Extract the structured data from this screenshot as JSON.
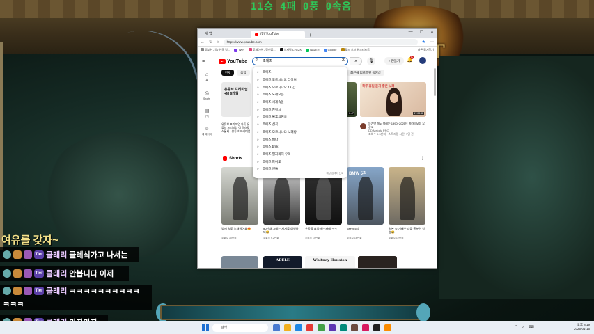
{
  "overlay": {
    "counter": "11승 4패 0풍 0속음",
    "chat_title": "여유를 갖자~",
    "messages": [
      {
        "user": "클래리",
        "text": "클레식가고 나서는"
      },
      {
        "user": "클래리",
        "text": "안봅니다 이제"
      },
      {
        "user": "클래리",
        "text": "ㅋㅋㅋㅋㅋㅋㅋㅋㅋㅋ"
      },
      {
        "user": "",
        "text": "ㅋㅋㅋ"
      },
      {
        "user": "클래리",
        "text": "마자마자"
      }
    ],
    "badge_label": "Tier",
    "game_logo": "FT"
  },
  "browser": {
    "tabs": [
      {
        "label": "새 탭"
      },
      {
        "label": "(8) YouTube"
      }
    ],
    "new_tab": "+",
    "window_controls": [
      "—",
      "☐",
      "✕"
    ],
    "url": "https://www.youtube.com",
    "bookmarks": [
      "맵부한 기능 연국 링...",
      "TWP",
      "투네이션 - 당신를...",
      "치지직 CHZZK",
      "NAVER",
      "Google",
      "월드 오브 워크래프트"
    ],
    "bookmarks_right": "다른 즐겨찾기"
  },
  "youtube": {
    "logo": "YouTube",
    "search_value": "조에즈",
    "search_clear": "✕",
    "create_label": "+ 만들기",
    "notif_count": "9+",
    "sidebar": [
      {
        "icon": "⌂",
        "label": "홈"
      },
      {
        "icon": "◎",
        "label": "Shorts"
      },
      {
        "icon": "▤",
        "label": "구독"
      },
      {
        "icon": "☺",
        "label": "내 페이지"
      }
    ],
    "chips": [
      "전체",
      "음악"
    ],
    "chip_right": "최근에 업로드된 동영상",
    "featured": {
      "thumb_text": "유튜브 프리미엄 +M 6개월",
      "caption": "유튜브 프리미엄 유튜 유튜브 프리미엄 이 택스로 스폰서 · 유튜브 프리미엄",
      "video_title_overlay": "하루 휴일 듣기 좋은 노래",
      "duration": "17:08:58",
      "side_duration": "2:47",
      "title": "듣기만 해도 설레는 1990~2025년 발라드모음 무광고",
      "channel": "DD Melody PRO",
      "stats": "조회수 9.5만회 · 스트리밍 시간: 7일 전"
    },
    "shorts_label": "Shorts",
    "shorts": [
      {
        "title": "밖에 속도 노래했어요😍",
        "views": "조회수 30만회"
      },
      {
        "title": "90년대 그레는 세계를 여행하다😂",
        "views": "조회수 9.2만회"
      },
      {
        "title": "우동을 요청하는 카레 ㅋㅋ",
        "views": "조회수 14만회"
      },
      {
        "title": "BMW 5리",
        "views": "조회수 16만회"
      },
      {
        "title": "일본 속 개배우 대를 흥분한 방송😂",
        "views": "조회수 12만회"
      }
    ],
    "shorts_tag": "BMW 5리",
    "bottom_label": "ADELE",
    "bottom_label2": "Whitney Houston",
    "suggestions": [
      "조에즈",
      "조에즈 모르시나요 라이브",
      "조에즈 모르시나요 1시간",
      "조에즈 노래모음",
      "조에즈 세계속돌",
      "조에즈 한정시",
      "조에즈 불후의명곡",
      "조에즈 신곡",
      "조에즈 모르시나요 노래방",
      "조에즈 배다",
      "조에즈 bmk",
      "조에즈 별자리처 우리",
      "조에즈 파이포",
      "조에즈 번들"
    ],
    "suggestion_footer": "예상 검색어 신고"
  },
  "taskbar": {
    "search_placeholder": "검색",
    "tray": "^ ♪ ⌨",
    "time": "오후 8:19",
    "date": "2025-01-15"
  }
}
